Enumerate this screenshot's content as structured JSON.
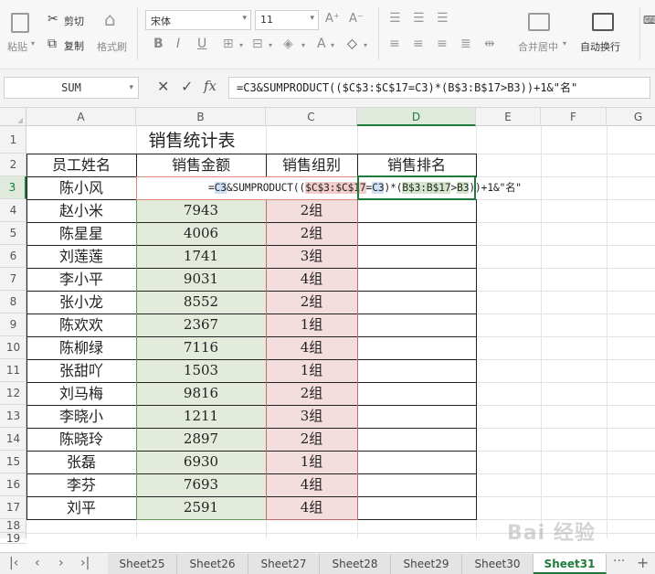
{
  "ribbon": {
    "paste": "粘贴",
    "cut": "剪切",
    "copy": "复制",
    "format_painter": "格式刷",
    "font_name": "宋体",
    "font_size": "11",
    "bold": "B",
    "italic": "I",
    "underline": "U",
    "font_color_glyph": "A",
    "font_grow": "A⁺",
    "font_shrink": "A⁻",
    "merge_center": "合并居中",
    "wrap_text": "自动换行"
  },
  "formula_bar": {
    "name_box": "SUM",
    "fx": "fx",
    "cancel": "✕",
    "confirm": "✓",
    "formula": "=C3&SUMPRODUCT(($C$3:$C$17=C3)*(B$3:B$17>B3))+1&\"名\""
  },
  "columns": [
    "A",
    "B",
    "C",
    "D",
    "E",
    "F",
    "G"
  ],
  "rows": [
    "1",
    "2",
    "3",
    "4",
    "5",
    "6",
    "7",
    "8",
    "9",
    "10",
    "11",
    "12",
    "13",
    "14",
    "15",
    "16",
    "17",
    "18",
    "19"
  ],
  "sheet": {
    "title": "销售统计表",
    "headers": [
      "员工姓名",
      "销售金额",
      "销售组别",
      "销售排名"
    ],
    "edit": {
      "p1": "=",
      "p2": "C3",
      "p3": "&SUMPRODUCT((",
      "p4": "$C$3:$C$17",
      "p5": "=",
      "p6": "C3",
      "p7": ")*(",
      "p8": "B$3:B$17",
      "p9": ">",
      "p10": "B3",
      "p11": "))+1&\"名\""
    },
    "data": [
      {
        "name": "陈小风",
        "amount": "",
        "group": ""
      },
      {
        "name": "赵小米",
        "amount": "7943",
        "group": "2组"
      },
      {
        "name": "陈星星",
        "amount": "4006",
        "group": "2组"
      },
      {
        "name": "刘莲莲",
        "amount": "1741",
        "group": "3组"
      },
      {
        "name": "李小平",
        "amount": "9031",
        "group": "4组"
      },
      {
        "name": "张小龙",
        "amount": "8552",
        "group": "2组"
      },
      {
        "name": "陈欢欢",
        "amount": "2367",
        "group": "1组"
      },
      {
        "name": "陈柳绿",
        "amount": "7116",
        "group": "4组"
      },
      {
        "name": "张甜吖",
        "amount": "1503",
        "group": "1组"
      },
      {
        "name": "刘马梅",
        "amount": "9816",
        "group": "2组"
      },
      {
        "name": "李晓小",
        "amount": "1211",
        "group": "3组"
      },
      {
        "name": "陈晓玲",
        "amount": "2897",
        "group": "2组"
      },
      {
        "name": "张磊",
        "amount": "6930",
        "group": "1组"
      },
      {
        "name": "李芬",
        "amount": "7693",
        "group": "4组"
      },
      {
        "name": "刘平",
        "amount": "2591",
        "group": "4组"
      }
    ]
  },
  "tabs": {
    "items": [
      "Sheet25",
      "Sheet26",
      "Sheet27",
      "Sheet28",
      "Sheet29",
      "Sheet30",
      "Sheet31"
    ],
    "active": "Sheet31",
    "more": "···",
    "add": "+"
  },
  "watermark": "Bai 经验",
  "colors": {
    "accent": "#1e7b3a",
    "ref_green": "#e2ebdc",
    "ref_red": "#f4dddd"
  }
}
